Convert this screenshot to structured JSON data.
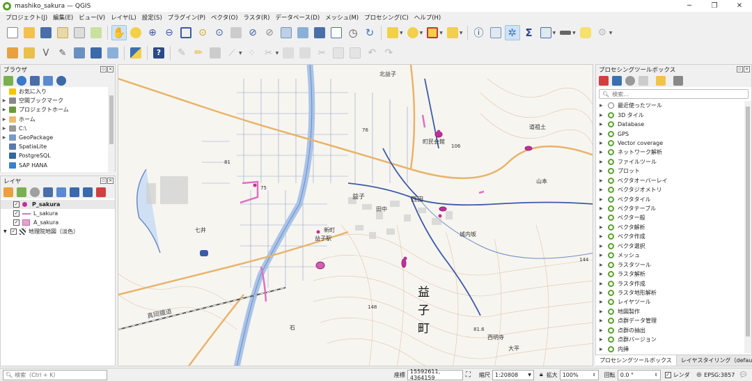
{
  "window": {
    "title": "mashiko_sakura — QGIS",
    "controls": [
      "─",
      "❐",
      "✕"
    ]
  },
  "menu": [
    "プロジェクト(J)",
    "編集(E)",
    "ビュー(V)",
    "レイヤ(L)",
    "設定(S)",
    "プラグイン(P)",
    "ベクタ(O)",
    "ラスタ(R)",
    "データベース(D)",
    "メッシュ(M)",
    "プロセシング(C)",
    "ヘルプ(H)"
  ],
  "browser": {
    "title": "ブラウザ",
    "items": [
      {
        "label": "お気に入り",
        "icon": "star-icon",
        "color": "#f5c400"
      },
      {
        "label": "空間ブックマーク",
        "icon": "bookmark-icon",
        "color": "#888888"
      },
      {
        "label": "プロジェクトホーム",
        "icon": "folder-icon",
        "color": "#6a9a3a"
      },
      {
        "label": "ホーム",
        "icon": "folder-icon",
        "color": "#e8c06a"
      },
      {
        "label": "C:\\",
        "icon": "drive-icon",
        "color": "#999999"
      },
      {
        "label": "GeoPackage",
        "icon": "geopackage-icon",
        "color": "#7a9ac8"
      },
      {
        "label": "SpatiaLite",
        "icon": "spatialite-icon",
        "color": "#5a7aa8"
      },
      {
        "label": "PostgreSQL",
        "icon": "postgresql-icon",
        "color": "#336699"
      },
      {
        "label": "SAP HANA",
        "icon": "saphana-icon",
        "color": "#3a80c8"
      }
    ]
  },
  "layers": {
    "title": "レイヤ",
    "items": [
      {
        "label": "P_sakura",
        "symbol": "point",
        "color": "#c0309a",
        "checked": true,
        "bold": true
      },
      {
        "label": "L_sakura",
        "symbol": "line",
        "color": "#e070c0",
        "checked": true,
        "bold": false
      },
      {
        "label": "A_sakura",
        "symbol": "polygon",
        "color": "#e8a0d0",
        "checked": true,
        "bold": false
      },
      {
        "label": "地理院地図（淡色）",
        "symbol": "raster",
        "color": "#444444",
        "checked": true,
        "bold": false
      }
    ]
  },
  "processing": {
    "title": "プロセシングツールボックス",
    "search_placeholder": "検索...",
    "items": [
      "最近使ったツール",
      "3D タイル",
      "Database",
      "GPS",
      "Vector coverage",
      "ネットワーク解析",
      "ファイルツール",
      "プロット",
      "ベクタオーバーレイ",
      "ベクタジオメトリ",
      "ベクタタイル",
      "ベクタテーブル",
      "ベクター般",
      "ベクタ解析",
      "ベクタ作成",
      "ベクタ選択",
      "メッシュ",
      "ラスタツール",
      "ラスタ解析",
      "ラスタ作成",
      "ラスタ地形解析",
      "レイヤツール",
      "地図製作",
      "点群データ管理",
      "点群の抽出",
      "点群バージョン",
      "内挿"
    ]
  },
  "tabs": [
    "プロセシングツールボックス",
    "レイヤスタイリング（default）"
  ],
  "map_labels": {
    "town_vertical": [
      "益",
      "子",
      "町"
    ],
    "places": [
      "北益子",
      "町民会館",
      "道祖土",
      "益子",
      "西田",
      "西明寺",
      "城内坂",
      "新町",
      "益子駅",
      "真岡鐵道",
      "石",
      "田中",
      "七井",
      "山本",
      "大平"
    ],
    "elevations": [
      "76",
      "106",
      "81",
      "75",
      "144",
      "148",
      "81.6"
    ]
  },
  "status": {
    "locator_placeholder": "検索（Ctrl + K）",
    "coord_label": "座標",
    "coordinates": "15592611, 4364159",
    "scale_label": "縮尺",
    "scale": "1:20808",
    "magnifier_label": "拡大",
    "magnifier": "100%",
    "rotation_label": "回転",
    "rotation": "0.0 °",
    "render_label": "レンダ",
    "crs": "EPSG:3857"
  },
  "colors": {
    "sakura_point": "#c0309a",
    "sakura_line": "#e070c0",
    "river": "#aac4e8",
    "road_main": "#e8b36a",
    "road_blue": "#3a5aa8"
  }
}
